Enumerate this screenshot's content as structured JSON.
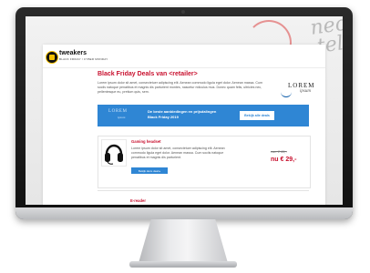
{
  "background": {
    "script_lines": [
      "neo",
      "tell"
    ]
  },
  "site": {
    "name": "tweakers",
    "tagline": "BLACK FRIDAY / CYBER MONDAY"
  },
  "headline": "Black Friday Deals van <retailer>",
  "intro": "Lorem ipsum dolor sit amet, consectetuer adipiscing elit. Aenean commodo ligula eget dolor. Aenean massa. Cum sociis natoque penatibus et magnis dis parturient montes, nascetur ridiculus mus. Donec quam felis, ultricies nec, pellentesque eu, pretium quis, sem.",
  "brand": {
    "name": "LOREM",
    "sub": "ipsum"
  },
  "banner": {
    "logo_name": "LOREM",
    "logo_sub": "ipsum",
    "text": "De beste aanbiedingen en prijsdalingen Black Friday 2019",
    "button": "Bekijk alle deals"
  },
  "products": [
    {
      "title": "Gaming headset",
      "description": "Lorem ipsum dolor sit amet, consectetuer adipiscing elit. Aenean commodo ligula eget dolor. Aenean massa. Cum sociis natoque penatibus et magnis dis parturient.",
      "button": "Bekijk deze deal ▸",
      "price_old": "van € 49,-",
      "price_new": "nu € 29,-",
      "icon": "headset-icon"
    },
    {
      "title": "E-reader",
      "icon": "e-reader-icon"
    }
  ],
  "colors": {
    "accent_red": "#c8102e",
    "banner_blue": "#2f86d4",
    "logo_yellow": "#f4c000"
  }
}
